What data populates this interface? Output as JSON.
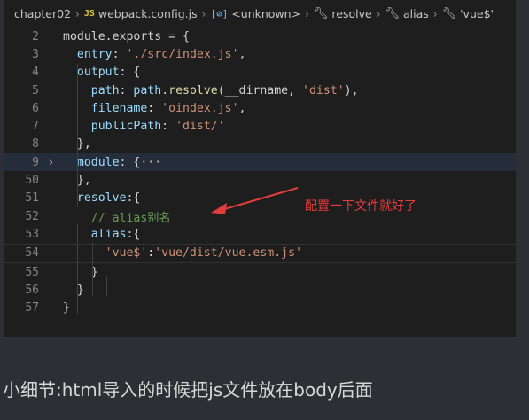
{
  "breadcrumb": {
    "folder": "chapter02",
    "file": "webpack.config.js",
    "file_icon": "JS",
    "sym1": "<unknown>",
    "sym2": "resolve",
    "sym3": "alias",
    "sym4": "'vue$'"
  },
  "code": {
    "lines": [
      {
        "num": "2",
        "t": [
          [
            "module.exports = {",
            "pun"
          ]
        ]
      },
      {
        "num": "3",
        "t": [
          [
            "  ",
            "pun"
          ],
          [
            "entry",
            "kw"
          ],
          [
            ": ",
            "pun"
          ],
          [
            "'./src/index.js'",
            "str"
          ],
          [
            ",",
            "pun"
          ]
        ]
      },
      {
        "num": "4",
        "t": [
          [
            "  ",
            "pun"
          ],
          [
            "output",
            "kw"
          ],
          [
            ": {",
            "pun"
          ]
        ]
      },
      {
        "num": "5",
        "t": [
          [
            "    ",
            "pun"
          ],
          [
            "path",
            "kw"
          ],
          [
            ": ",
            "pun"
          ],
          [
            "path",
            "kw"
          ],
          [
            ".",
            "pun"
          ],
          [
            "resolve",
            "fn"
          ],
          [
            "(__dirname, ",
            "pun"
          ],
          [
            "'dist'",
            "str"
          ],
          [
            "),",
            "pun"
          ]
        ]
      },
      {
        "num": "6",
        "t": [
          [
            "    ",
            "pun"
          ],
          [
            "filename",
            "kw"
          ],
          [
            ": ",
            "pun"
          ],
          [
            "'oindex.js'",
            "str"
          ],
          [
            ",",
            "pun"
          ]
        ]
      },
      {
        "num": "7",
        "t": [
          [
            "    ",
            "pun"
          ],
          [
            "publicPath",
            "kw"
          ],
          [
            ": ",
            "pun"
          ],
          [
            "'dist/'",
            "str"
          ]
        ]
      },
      {
        "num": "8",
        "t": [
          [
            "  },",
            "pun"
          ]
        ]
      },
      {
        "num": "9",
        "t": [
          [
            "  ",
            "pun"
          ],
          [
            "module",
            "kw"
          ],
          [
            ": {",
            "pun"
          ],
          [
            "···",
            "collapsed"
          ]
        ],
        "folded": true
      },
      {
        "num": "50",
        "t": [
          [
            "  },",
            "pun"
          ]
        ]
      },
      {
        "num": "51",
        "t": [
          [
            "  ",
            "pun"
          ],
          [
            "resolve",
            "kw"
          ],
          [
            ":{",
            "pun"
          ]
        ]
      },
      {
        "num": "52",
        "t": [
          [
            "    ",
            "pun"
          ],
          [
            "// alias别名",
            "com"
          ]
        ]
      },
      {
        "num": "53",
        "t": [
          [
            "    ",
            "pun"
          ],
          [
            "alias",
            "kw"
          ],
          [
            ":{",
            "pun"
          ]
        ]
      },
      {
        "num": "54",
        "t": [
          [
            "      ",
            "pun"
          ],
          [
            "'vue$'",
            "str"
          ],
          [
            ":",
            "pun"
          ],
          [
            "'vue/dist/vue.esm.js'",
            "str"
          ]
        ]
      },
      {
        "num": "55",
        "t": [
          [
            "    }",
            "pun"
          ]
        ]
      },
      {
        "num": "56",
        "t": [
          [
            "  }",
            "pun"
          ]
        ]
      },
      {
        "num": "57",
        "t": [
          [
            "}",
            "pun"
          ]
        ]
      }
    ]
  },
  "annotation": "配置一下文件就好了",
  "caption": "小细节:html导入的时候把js文件放在body后面",
  "colors": {
    "annotation": "#e33c3c",
    "editor_bg": "#1e1e1e",
    "page_bg": "#2d2f34"
  }
}
